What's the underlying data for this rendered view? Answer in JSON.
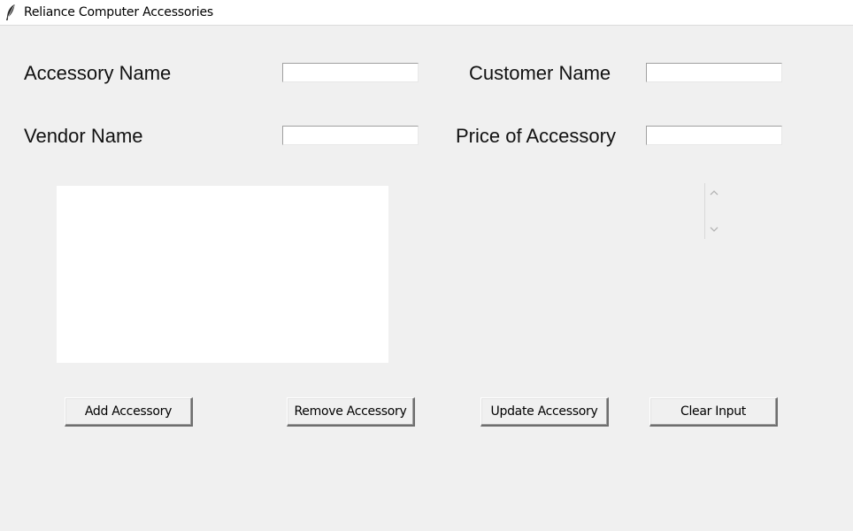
{
  "window": {
    "title": "Reliance Computer Accessories",
    "icon": "feather-icon"
  },
  "form": {
    "accessory_name_label": "Accessory Name",
    "customer_name_label": "Customer Name",
    "vendor_name_label": "Vendor Name",
    "price_label": "Price of Accessory",
    "accessory_name_value": "",
    "customer_name_value": "",
    "vendor_name_value": "",
    "price_value": ""
  },
  "listbox": {
    "items": []
  },
  "scrollbar": {
    "up_icon": "chevron-up-icon",
    "down_icon": "chevron-down-icon"
  },
  "buttons": {
    "add": "Add Accessory",
    "remove": "Remove Accessory",
    "update": "Update Accessory",
    "clear": "Clear Input"
  },
  "colors": {
    "background": "#f0f0f0",
    "titlebar": "#ffffff",
    "listbox": "#ffffff"
  }
}
